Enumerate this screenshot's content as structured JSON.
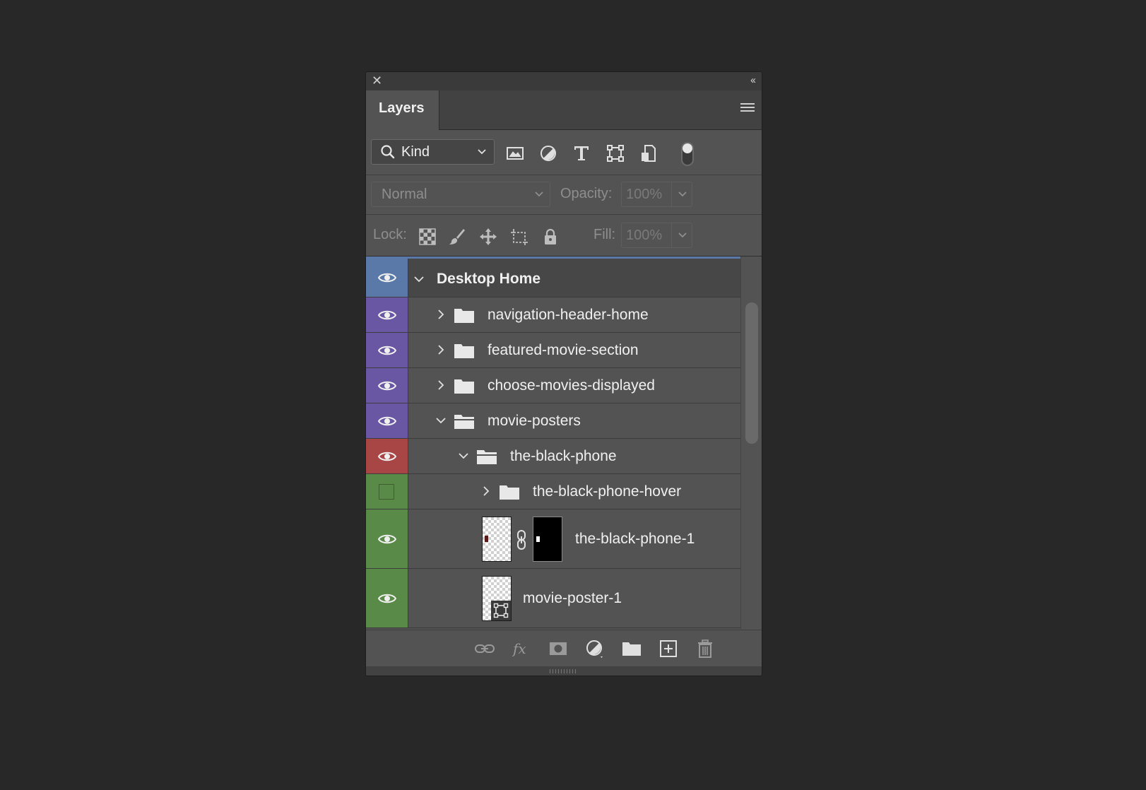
{
  "panel": {
    "tab_label": "Layers",
    "close_icon": "close-icon",
    "collapse_icon": "double-chevron-left-icon",
    "menu_icon": "panel-menu-icon"
  },
  "filter": {
    "kind_label": "Kind",
    "icons": [
      "image-filter-icon",
      "adjustment-filter-icon",
      "type-filter-icon",
      "shape-filter-icon",
      "smart-object-filter-icon"
    ]
  },
  "blend": {
    "mode": "Normal",
    "opacity_label": "Opacity:",
    "opacity_value": "100%"
  },
  "lock": {
    "label": "Lock:",
    "fill_label": "Fill:",
    "fill_value": "100%"
  },
  "layers": [
    {
      "name": "Desktop Home",
      "type": "artboard",
      "expanded": true,
      "visible": true,
      "color": "#5a78a8"
    },
    {
      "name": "navigation-header-home",
      "type": "group",
      "expanded": false,
      "visible": true,
      "color": "#6a57a4"
    },
    {
      "name": "featured-movie-section",
      "type": "group",
      "expanded": false,
      "visible": true,
      "color": "#6a57a4"
    },
    {
      "name": "choose-movies-displayed",
      "type": "group",
      "expanded": false,
      "visible": true,
      "color": "#6a57a4"
    },
    {
      "name": "movie-posters",
      "type": "group",
      "expanded": true,
      "visible": true,
      "color": "#6a57a4"
    },
    {
      "name": "the-black-phone",
      "type": "group",
      "expanded": true,
      "visible": true,
      "color": "#a84646"
    },
    {
      "name": "the-black-phone-hover",
      "type": "group",
      "expanded": false,
      "visible": false,
      "color": "#5a8a48"
    },
    {
      "name": "the-black-phone-1",
      "type": "masked-layer",
      "visible": true,
      "color": "#5a8a48"
    },
    {
      "name": "movie-poster-1",
      "type": "smart-object",
      "visible": true,
      "color": "#5a8a48"
    }
  ],
  "bottom_icons": [
    "link-layers-icon",
    "fx-icon",
    "add-mask-icon",
    "adjustment-layer-icon",
    "new-group-icon",
    "new-layer-icon",
    "delete-icon"
  ]
}
